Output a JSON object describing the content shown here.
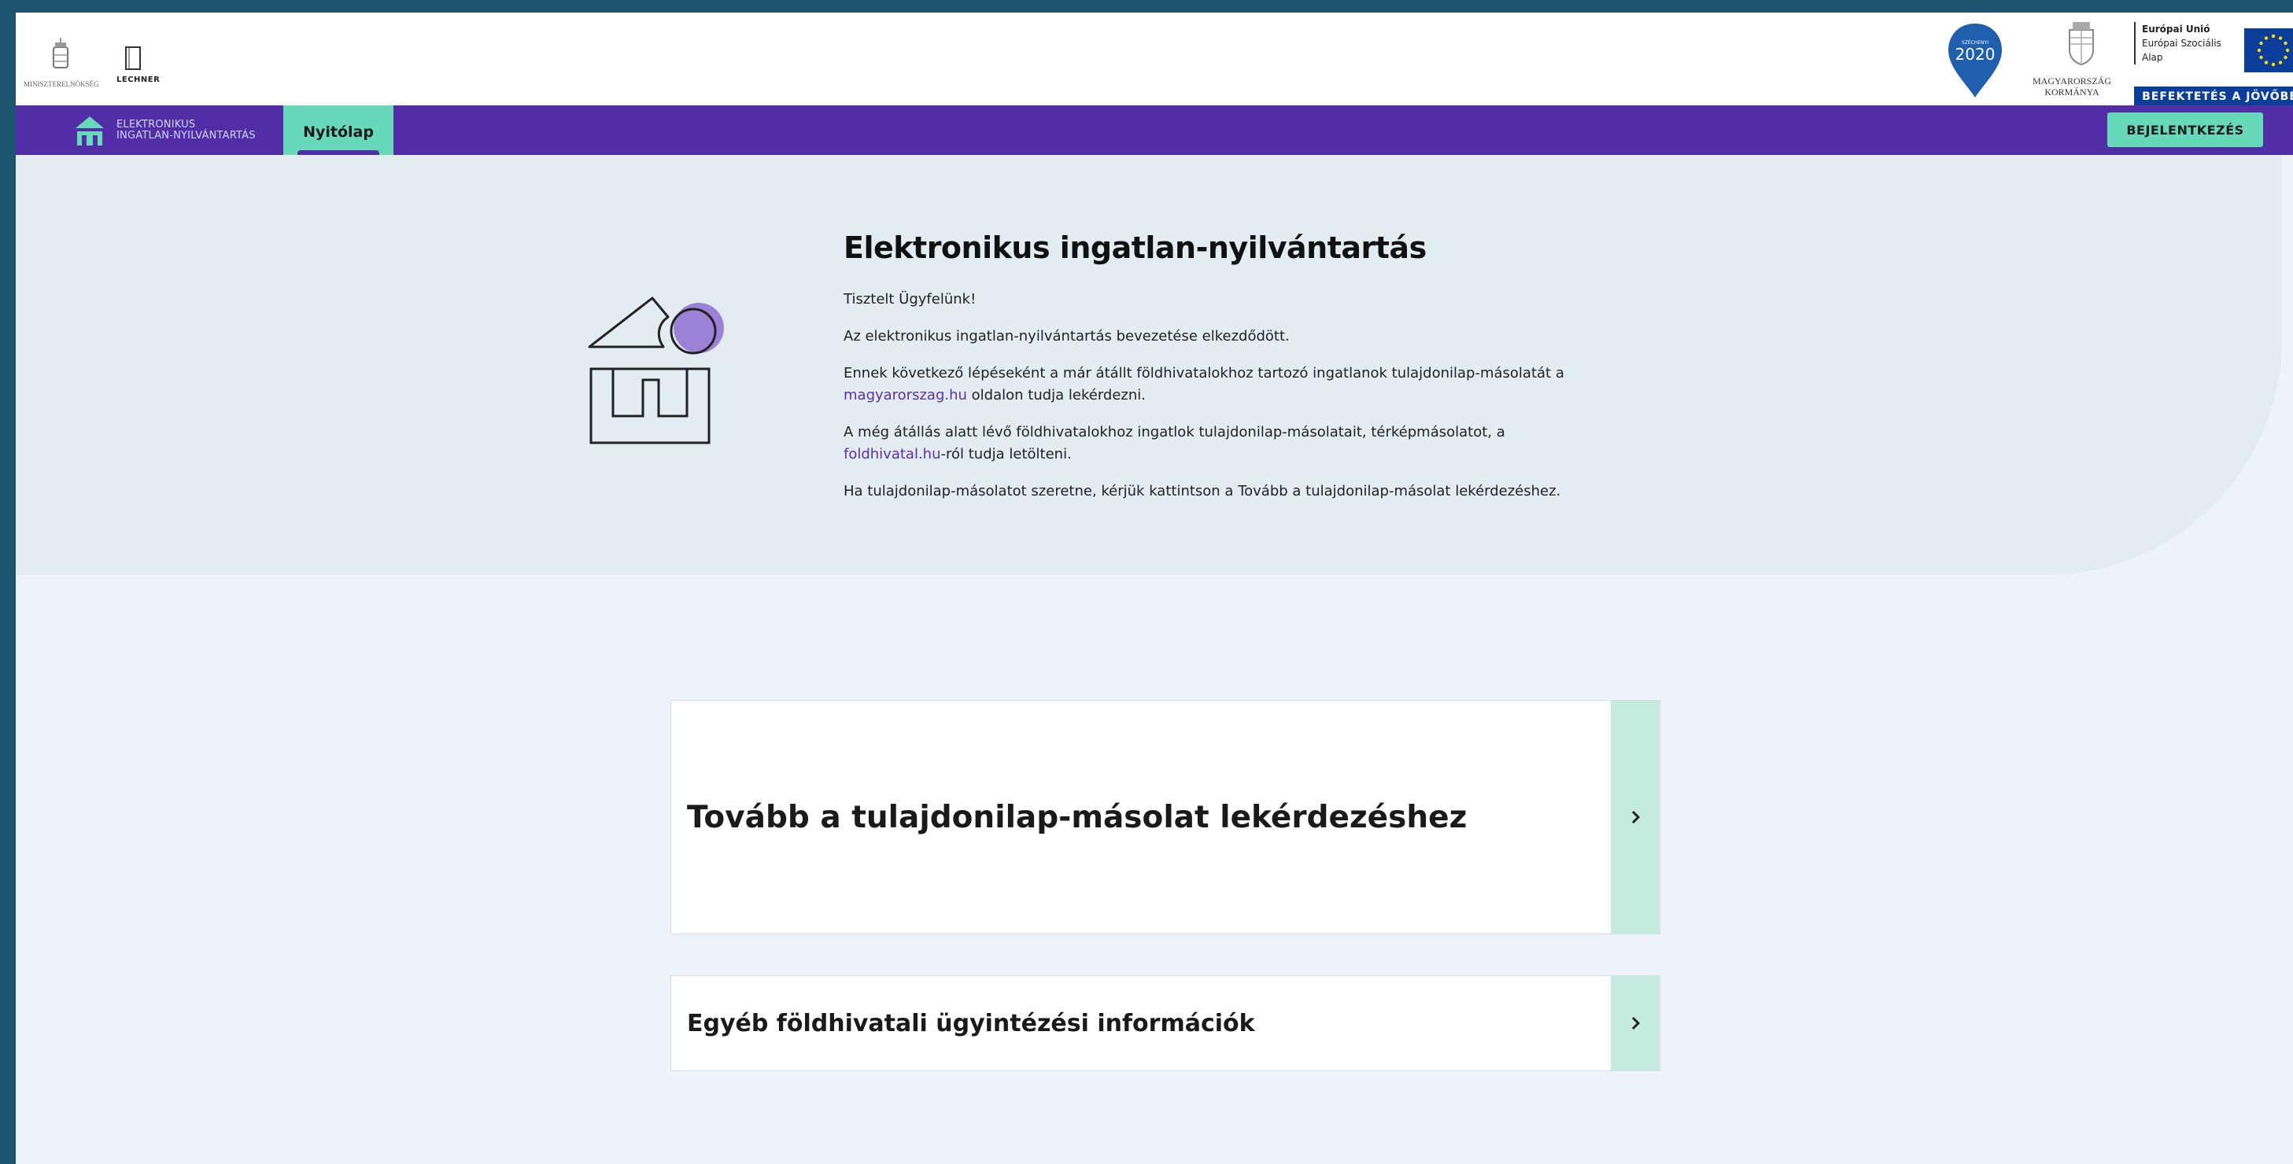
{
  "header": {
    "ministry_caption": "MINISZTERELNÖKSÉG",
    "lechner_label": "LECHNER",
    "badge_2020_top": "SZÉCHENYI",
    "badge_2020_year": "2020",
    "government_line1": "MAGYARORSZÁG",
    "government_line2": "KORMÁNYA",
    "eu_line1": "Európai Unió",
    "eu_line2": "Európai Szociális",
    "eu_line3": "Alap",
    "eu_banner": "BEFEKTETÉS A JÖVŐBE"
  },
  "nav": {
    "brand_line1": "ELEKTRONIKUS",
    "brand_line2": "INGATLAN-NYILVÁNTARTÁS",
    "tab_home": "Nyitólap",
    "login": "BEJELENTKEZÉS"
  },
  "hero": {
    "title": "Elektronikus ingatlan-nyilvántartás",
    "greeting": "Tisztelt Ügyfelünk!",
    "p1": "Az elektronikus ingatlan-nyilvántartás bevezetése elkezdődött.",
    "p2_before": "Ennek következő lépéseként a már átállt földhivatalokhoz tartozó ingatlanok tulajdonilap-másolatát a",
    "p2_link": "magyarorszag.hu",
    "p2_after": " oldalon tudja lekérdezni.",
    "p3_before": "A még átállás alatt lévő földhivatalokhoz ingatlok tulajdonilap-másolatait, térképmásolatot, a",
    "p3_link": "foldhivatal.hu",
    "p3_after": "-ról tudja letölteni.",
    "p4": "Ha tulajdonilap-másolatot szeretne, kérjük kattintson a Tovább a tulajdonilap-másolat lekérdezéshez."
  },
  "cards": {
    "main": "Tovább a tulajdonilap-másolat lekérdezéshez",
    "secondary": "Egyéb földhivatali ügyintézési információk"
  },
  "colors": {
    "nav_bg": "#512da8",
    "accent": "#66d9b8",
    "hero_bg": "#e2ecf1",
    "page_bg": "#eef2fa",
    "eu_blue": "#0b3d9a",
    "link": "#5b2fb0"
  }
}
